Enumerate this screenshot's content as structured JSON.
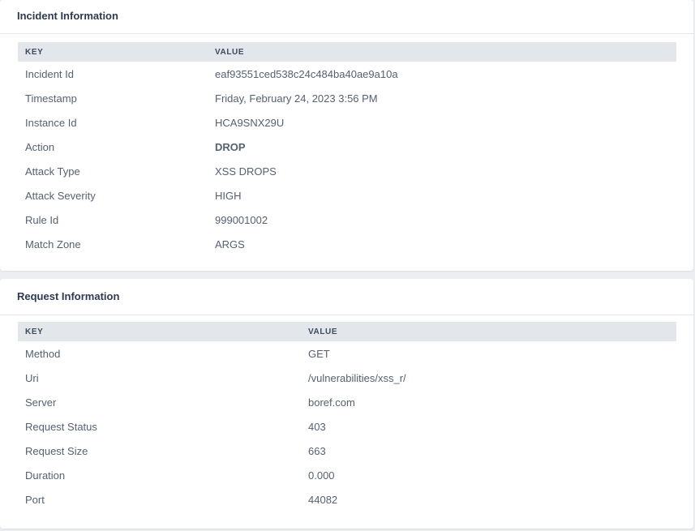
{
  "incident": {
    "title": "Incident Information",
    "columns": {
      "key": "KEY",
      "value": "VALUE"
    },
    "rows": [
      {
        "key": "Incident Id",
        "value": "eaf93551ced538c24c484ba40ae9a10a"
      },
      {
        "key": "Timestamp",
        "value": "Friday, February 24, 2023 3:56 PM"
      },
      {
        "key": "Instance Id",
        "value": "HCA9SNX29U"
      },
      {
        "key": "Action",
        "value": "DROP"
      },
      {
        "key": "Attack Type",
        "value": "XSS DROPS"
      },
      {
        "key": "Attack Severity",
        "value": "HIGH"
      },
      {
        "key": "Rule Id",
        "value": "999001002"
      },
      {
        "key": "Match Zone",
        "value": "ARGS"
      }
    ]
  },
  "request": {
    "title": "Request Information",
    "columns": {
      "key": "KEY",
      "value": "VALUE"
    },
    "rows": [
      {
        "key": "Method",
        "value": "GET"
      },
      {
        "key": "Uri",
        "value": "/vulnerabilities/xss_r/"
      },
      {
        "key": "Server",
        "value": "boref.com"
      },
      {
        "key": "Request Status",
        "value": "403"
      },
      {
        "key": "Request Size",
        "value": "663"
      },
      {
        "key": "Duration",
        "value": "0.000"
      },
      {
        "key": "Port",
        "value": "44082"
      }
    ]
  }
}
